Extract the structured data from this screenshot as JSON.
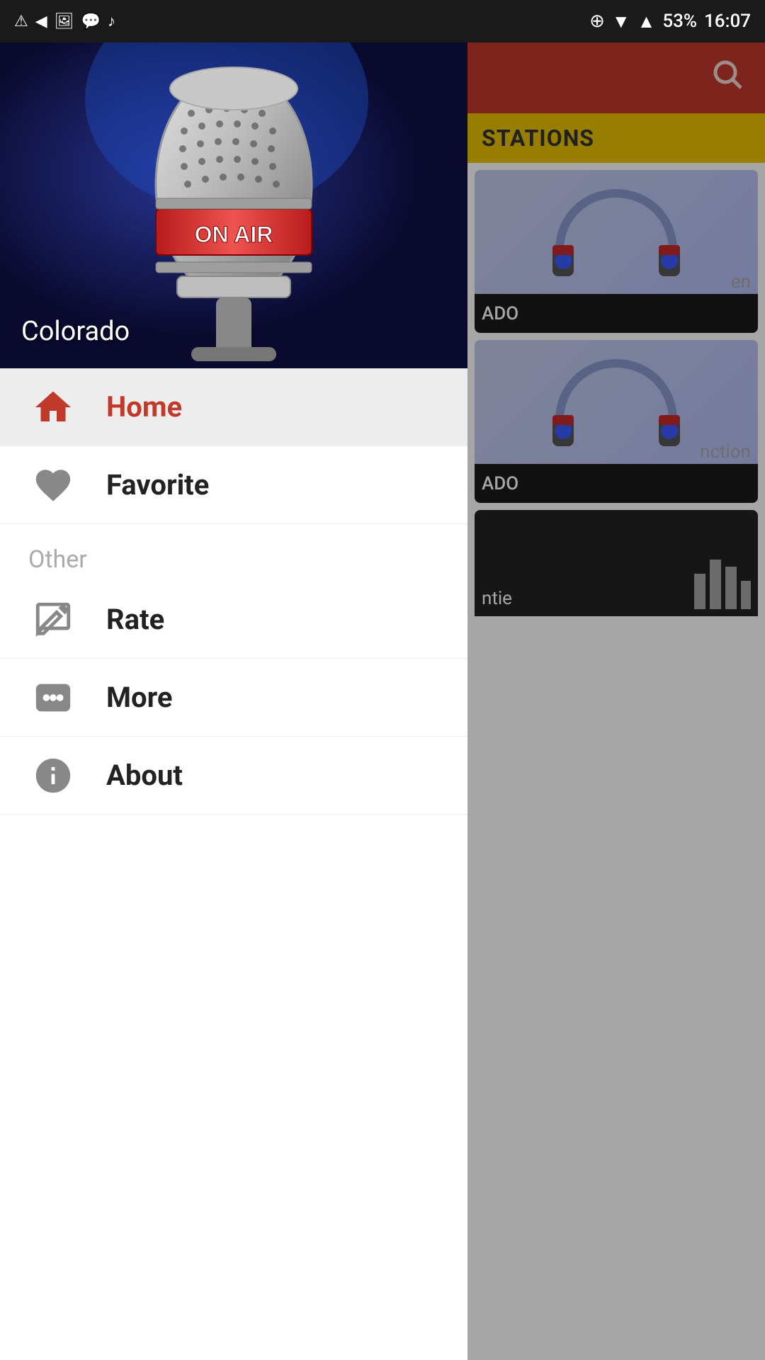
{
  "statusBar": {
    "time": "16:07",
    "battery": "53%",
    "icons": [
      "notification",
      "back",
      "image",
      "message",
      "music",
      "add",
      "wifi",
      "signal1",
      "signal2",
      "battery"
    ]
  },
  "hero": {
    "label": "Colorado",
    "imageAlt": "On Air Microphone"
  },
  "menu": {
    "home": {
      "label": "Home",
      "active": true
    },
    "favorite": {
      "label": "Favorite"
    },
    "sectionOther": "Other",
    "rate": {
      "label": "Rate"
    },
    "more": {
      "label": "More"
    },
    "about": {
      "label": "About"
    }
  },
  "mainContent": {
    "searchIcon": "🔍",
    "stationsLabel": "STATIONS",
    "stations": [
      {
        "name": "ADO",
        "subtext": "en"
      },
      {
        "name": "ADO",
        "subtext": "nction"
      },
      {
        "name": "ntie",
        "subtext": ""
      }
    ]
  }
}
